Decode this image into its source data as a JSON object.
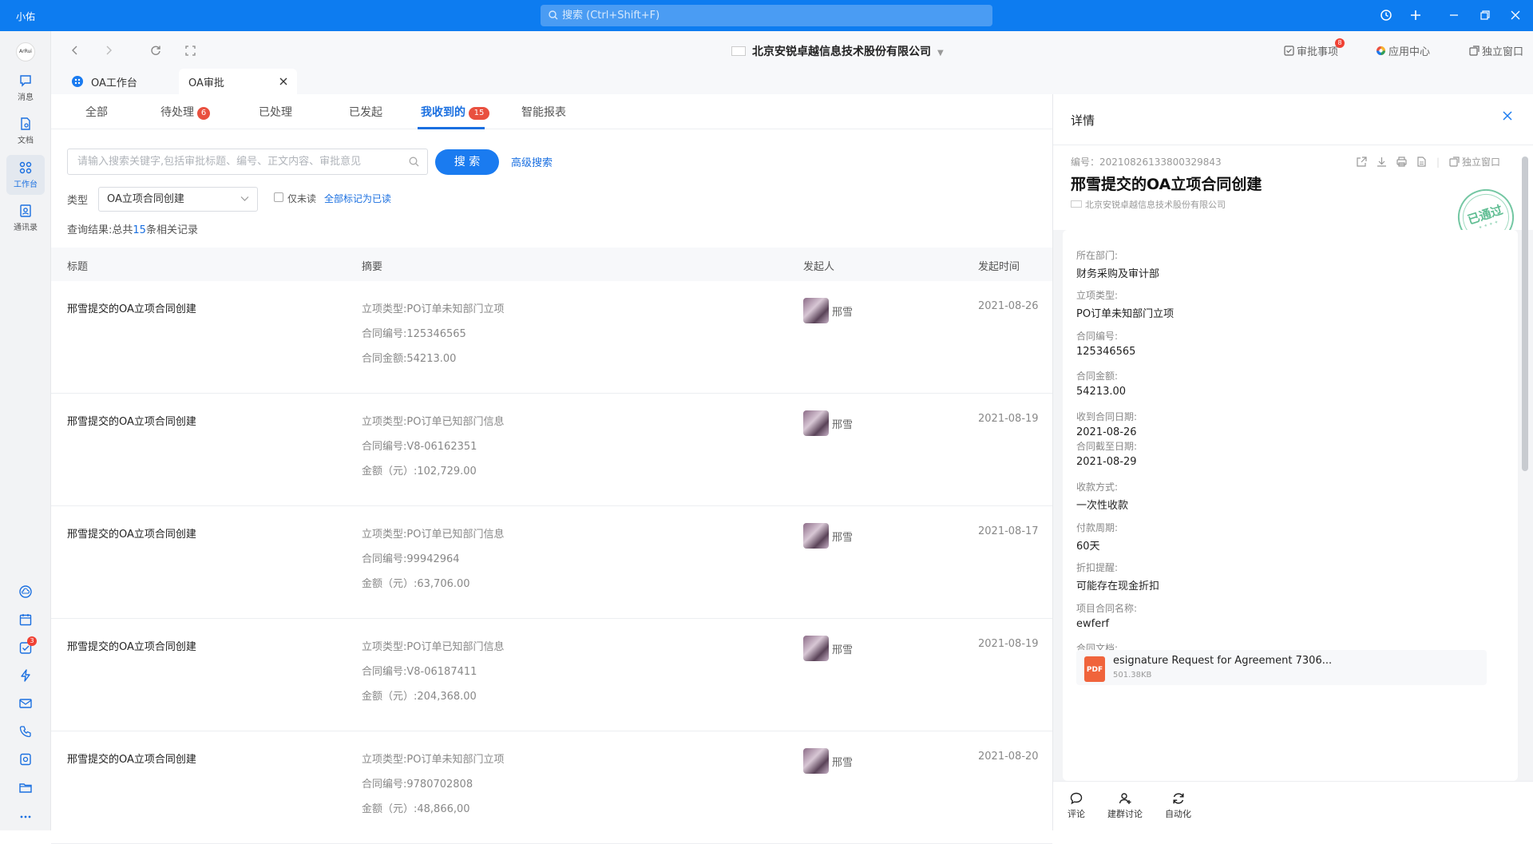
{
  "app": {
    "name": "小佑"
  },
  "global_search": {
    "placeholder": "搜索 (Ctrl+Shift+F)"
  },
  "nav": {
    "items": [
      {
        "label": "消息"
      },
      {
        "label": "文档"
      },
      {
        "label": "工作台"
      },
      {
        "label": "通讯录"
      }
    ],
    "todo_badge": "3"
  },
  "header": {
    "company": "北京安锐卓越信息技术股份有限公司",
    "approvals_label": "审批事项",
    "approvals_badge": "8",
    "app_center_label": "应用中心",
    "standalone_label": "独立窗口",
    "logo_text": "ArRui"
  },
  "window_tabs": [
    {
      "label": "OA工作台"
    },
    {
      "label": "OA审批"
    }
  ],
  "subtabs": [
    {
      "label": "全部"
    },
    {
      "label": "待处理",
      "count": "6"
    },
    {
      "label": "已处理"
    },
    {
      "label": "已发起"
    },
    {
      "label": "我收到的",
      "count": "15"
    },
    {
      "label": "智能报表"
    }
  ],
  "filters": {
    "search_placeholder": "请输入搜索关键字,包括审批标题、编号、正文内容、审批意见",
    "search_button": "搜 索",
    "advanced_search": "高级搜索",
    "type_label": "类型",
    "type_value": "OA立项合同创建",
    "unread_only": "仅未读",
    "mark_all_read": "全部标记为已读",
    "result_prefix": "查询结果:总共",
    "result_count": "15",
    "result_suffix": "条相关记录"
  },
  "table": {
    "columns": [
      "标题",
      "摘要",
      "发起人",
      "发起时间"
    ],
    "rows": [
      {
        "title": "邢雪提交的OA立项合同创建",
        "summary": [
          "立项类型:PO订单未知部门立项",
          "合同编号:125346565",
          "合同金额:54213.00"
        ],
        "initiator": "邢雪",
        "date": "2021-08-26"
      },
      {
        "title": "邢雪提交的OA立项合同创建",
        "summary": [
          "立项类型:PO订单已知部门信息",
          "合同编号:V8-06162351",
          "金额（元）:102,729.00"
        ],
        "initiator": "邢雪",
        "date": "2021-08-19"
      },
      {
        "title": "邢雪提交的OA立项合同创建",
        "summary": [
          "立项类型:PO订单已知部门信息",
          "合同编号:99942964",
          "金额（元）:63,706.00"
        ],
        "initiator": "邢雪",
        "date": "2021-08-17"
      },
      {
        "title": "邢雪提交的OA立项合同创建",
        "summary": [
          "立项类型:PO订单已知部门信息",
          "合同编号:V8-06187411",
          "金额（元）:204,368.00"
        ],
        "initiator": "邢雪",
        "date": "2021-08-19"
      },
      {
        "title": "邢雪提交的OA立项合同创建",
        "summary": [
          "立项类型:PO订单未知部门立项",
          "合同编号:9780702808",
          "金额（元）:48,866,00"
        ],
        "initiator": "邢雪",
        "date": "2021-08-20"
      }
    ]
  },
  "detail": {
    "header": "详情",
    "number": "编号：20210826133800329843",
    "standalone": "独立窗口",
    "title": "邢雪提交的OA立项合同创建",
    "company": "北京安锐卓越信息技术股份有限公司",
    "stamp": "已通过",
    "fields": [
      {
        "key": "所在部门:",
        "value": "财务采购及审计部"
      },
      {
        "key": "立项类型:",
        "value": "PO订单未知部门立项"
      },
      {
        "key": "合同编号:",
        "value": "125346565"
      },
      {
        "key": "合同金额:",
        "value": "54213.00"
      },
      {
        "key": "收到合同日期:",
        "value": "2021-08-26"
      },
      {
        "key": "合同截至日期:",
        "value": "2021-08-29"
      },
      {
        "key": "收款方式:",
        "value": "一次性收款"
      },
      {
        "key": "付款周期:",
        "value": "60天"
      },
      {
        "key": "折扣提醒:",
        "value": "可能存在现金折扣"
      },
      {
        "key": "项目合同名称:",
        "value": "ewferf"
      },
      {
        "key": "合同文档:",
        "value": ""
      }
    ],
    "file": {
      "type": "PDF",
      "name": "esignature Request for Agreement 7306...",
      "size": "501.38KB"
    },
    "actions": [
      {
        "label": "评论"
      },
      {
        "label": "建群讨论"
      },
      {
        "label": "自动化"
      }
    ]
  },
  "colors": {
    "accent": "#1a6fe0",
    "titlebar": "#0d7cf0",
    "badge": "#e9503f",
    "stamp": "#5fbd92"
  }
}
